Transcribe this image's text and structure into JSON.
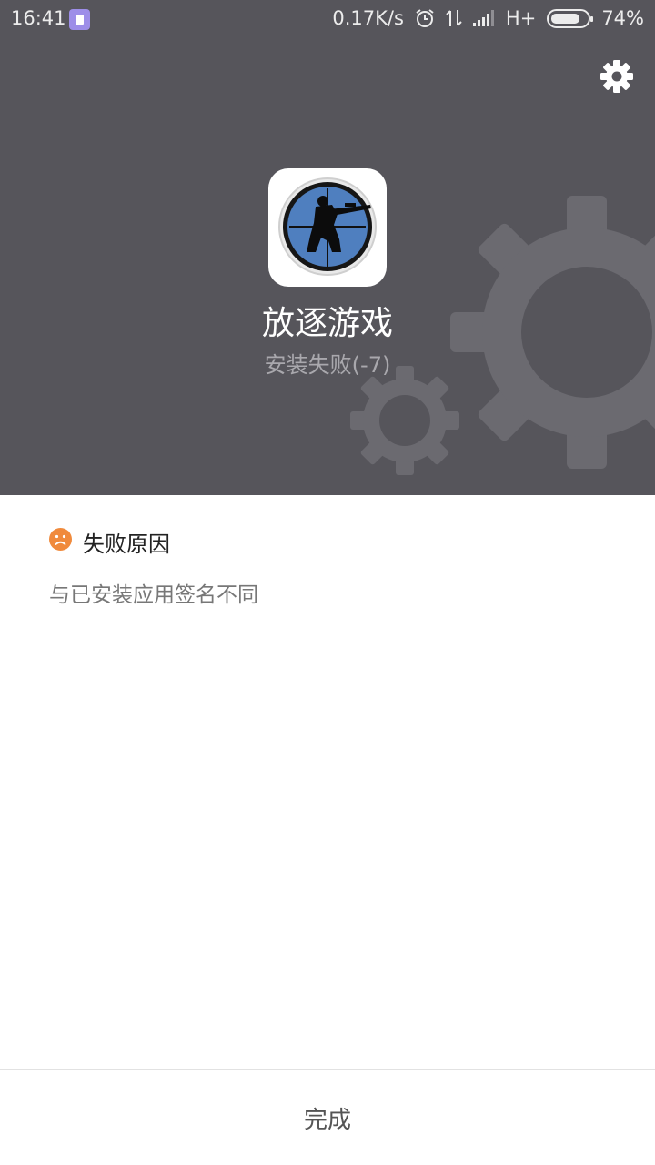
{
  "status_bar": {
    "time": "16:41",
    "network_speed": "0.17K/s",
    "network_type": "H+",
    "battery_percent": "74%",
    "battery_level": 0.74,
    "icons": [
      "notification-app-icon",
      "alarm-icon",
      "data-transfer-icon",
      "signal-icon",
      "battery-icon"
    ]
  },
  "header": {
    "app_name": "放逐游戏",
    "install_status": "安装失败(-7)",
    "background_color": "#56555b",
    "settings_icon": "gear-icon"
  },
  "reason": {
    "title": "失败原因",
    "detail": "与已安装应用签名不同",
    "icon": "sad-face-icon",
    "icon_color": "#f08a3c"
  },
  "footer": {
    "done_label": "完成"
  }
}
